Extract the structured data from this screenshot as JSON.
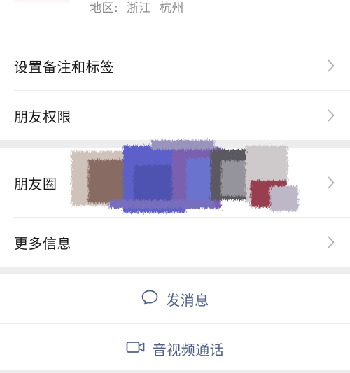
{
  "profile": {
    "region": "地区:  浙江  杭州"
  },
  "menu": {
    "items": [
      {
        "label": "设置备注和标签"
      },
      {
        "label": "朋友权限"
      },
      {
        "label": "朋友圈"
      },
      {
        "label": "更多信息"
      }
    ]
  },
  "actions": {
    "message_label": "发消息",
    "call_label": "音视频通话"
  },
  "icons": {
    "chevron": "chevron-right-icon",
    "message": "chat-bubble-icon",
    "call": "video-camera-icon"
  },
  "colors": {
    "action_text": "#4f6188",
    "chevron": "#b2b2b2",
    "section_gap": "#ededed"
  }
}
